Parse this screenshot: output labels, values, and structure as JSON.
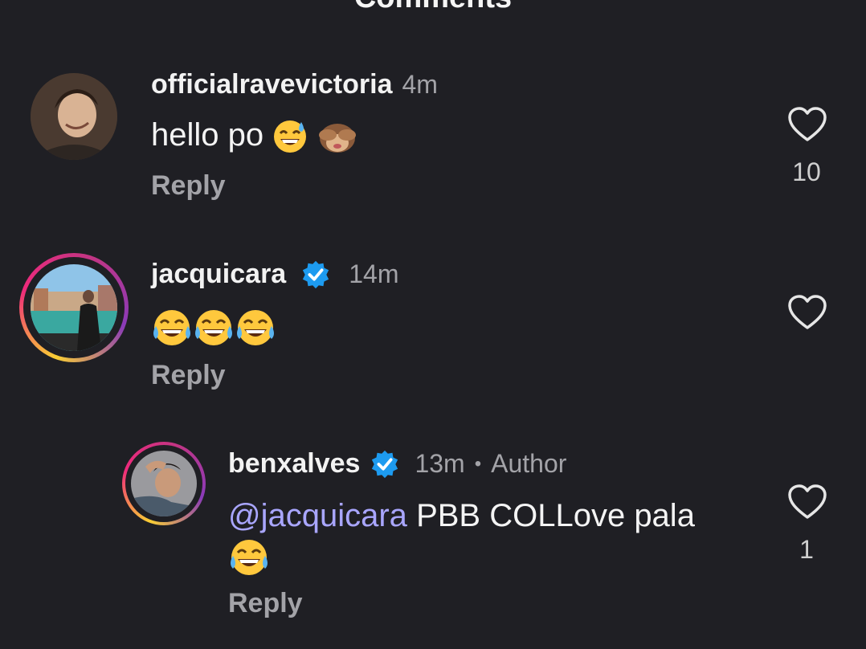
{
  "sheet": {
    "title": "Comments"
  },
  "comments": [
    {
      "username": "officialravevictoria",
      "time": "4m",
      "text": "hello po",
      "emojis": [
        "sweat-smile",
        "see-no-evil-monkey"
      ],
      "reply_label": "Reply",
      "likes": "10"
    },
    {
      "username": "jacquicara",
      "verified": true,
      "time": "14m",
      "text": "",
      "emojis": [
        "joy",
        "joy",
        "joy"
      ],
      "reply_label": "Reply",
      "likes": ""
    }
  ],
  "reply": {
    "username": "benxalves",
    "verified": true,
    "time": "13m",
    "separator": "•",
    "tag": "Author",
    "mention": "@jacquicara",
    "text": "PBB COLLove pala",
    "emojis": [
      "joy"
    ],
    "reply_label": "Reply",
    "likes": "1"
  },
  "colors": {
    "background": "#1f1f24",
    "mention": "#a9a6ff",
    "verified": "#1d9bf0",
    "muted": "#a3a3a8"
  }
}
